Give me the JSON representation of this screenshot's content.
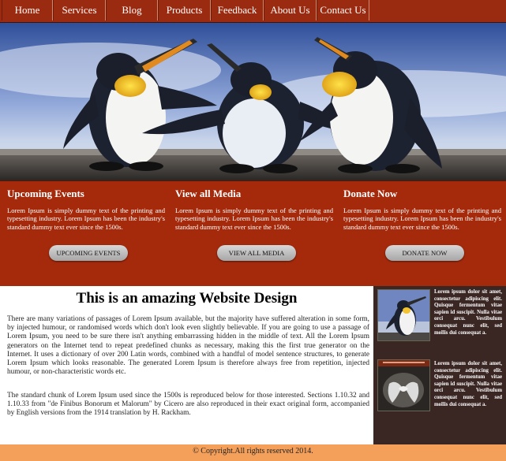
{
  "nav": {
    "items": [
      {
        "label": "Home"
      },
      {
        "label": "Services"
      },
      {
        "label": "Blog"
      },
      {
        "label": "Products"
      },
      {
        "label": "Feedback"
      },
      {
        "label": "About Us"
      },
      {
        "label": "Contact Us"
      }
    ]
  },
  "features": [
    {
      "title": "Upcoming Events",
      "text": "Lorem Ipsum is simply dummy text of the printing and typesetting industry. Lorem Ipsum has been the industry's standard dummy text ever since the 1500s.",
      "button": "UPCOMING EVENTS"
    },
    {
      "title": "View all Media",
      "text": "Lorem Ipsum is simply dummy text of the printing and typesetting industry. Lorem Ipsum has been the industry's standard dummy text ever since the 1500s.",
      "button": "VIEW ALL MEDIA"
    },
    {
      "title": "Donate Now",
      "text": "Lorem Ipsum is simply dummy text of the printing and typesetting industry. Lorem Ipsum has been the industry's standard dummy text ever since the 1500s.",
      "button": "DONATE NOW"
    }
  ],
  "main": {
    "heading": "This is an amazing Website Design",
    "paragraphs": [
      "There are many variations of passages of Lorem Ipsum available, but the majority have suffered alteration in some form, by injected humour, or randomised words which don't look even slightly believable. If you are going to use a passage of Lorem Ipsum, you need to be sure there isn't anything embarrassing hidden in the middle of text. All the Lorem Ipsum generators on the Internet tend to repeat predefined chunks as necessary, making this the first true generator on the Internet. It uses a dictionary of over 200 Latin words, combined with a handful of model sentence structures, to generate Lorem Ipsum which looks reasonable. The generated Lorem Ipsum is therefore always free from repetition, injected humour, or non-characteristic words etc.",
      "The standard chunk of Lorem Ipsum used since the 1500s is reproduced below for those interested. Sections 1.10.32 and 1.10.33 from \"de Finibus Bonorum et Malorum\" by Cicero are also reproduced in their exact original form, accompanied by English versions from the 1914 translation by H. Rackham."
    ]
  },
  "sidebar": {
    "items": [
      {
        "text": "Lorem ipsum dolor sit amet, consectetur adipiscing elit. Quisque fermentum vitae sapien id suscipit. Nulla vitae orci arcu. Vestibulum consequat nunc elit, sed mollis dui consequat a."
      },
      {
        "text": "Lorem ipsum dolor sit amet, consectetur adipiscing elit. Quisque fermentum vitae sapien id suscipit. Nulla vitae orci arcu. Vestibulum consequat nunc elit, sed mollis dui consequat a."
      }
    ]
  },
  "footer": {
    "copyright": "© Copyright.All rights reserved 2014."
  },
  "colors": {
    "nav_bg": "#9a2a10",
    "feature_bg": "#a52a0c",
    "sidebar_bg": "#3a2623",
    "footer_bg": "#f5a05a"
  }
}
